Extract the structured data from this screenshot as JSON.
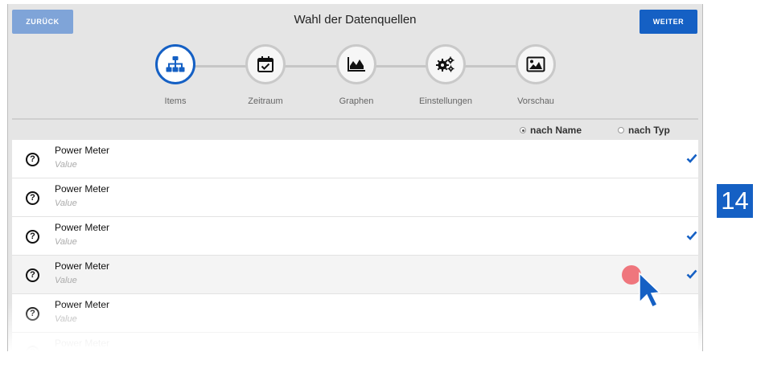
{
  "header": {
    "title": "Wahl der Datenquellen",
    "back_label": "ZURÜCK",
    "next_label": "WEITER"
  },
  "steps": [
    {
      "label": "Items",
      "icon": "sitemap-icon",
      "active": true
    },
    {
      "label": "Zeitraum",
      "icon": "calendar-check-icon",
      "active": false
    },
    {
      "label": "Graphen",
      "icon": "area-chart-icon",
      "active": false
    },
    {
      "label": "Einstellungen",
      "icon": "gears-icon",
      "active": false
    },
    {
      "label": "Vorschau",
      "icon": "image-icon",
      "active": false
    }
  ],
  "sort": {
    "by_name_label": "nach Name",
    "by_type_label": "nach Typ",
    "selected": "nach Name"
  },
  "items": [
    {
      "name": "Power Meter",
      "value": "Value",
      "icon": "question-circle-icon",
      "checked": true
    },
    {
      "name": "Power Meter",
      "value": "Value",
      "icon": "question-circle-icon",
      "checked": false
    },
    {
      "name": "Power Meter",
      "value": "Value",
      "icon": "question-circle-icon",
      "checked": true
    },
    {
      "name": "Power Meter",
      "value": "Value",
      "icon": "question-circle-icon",
      "checked": true
    },
    {
      "name": "Power Meter",
      "value": "Value",
      "icon": "question-circle-icon",
      "checked": false
    },
    {
      "name": "Power Meter",
      "value": "",
      "icon": "question-circle-icon",
      "checked": false
    }
  ],
  "page_badge": "14",
  "colors": {
    "accent": "#1560c4",
    "back_button": "#7fa4d8",
    "touch_indicator": "#ee6f76",
    "background": "#e5e5e5"
  }
}
